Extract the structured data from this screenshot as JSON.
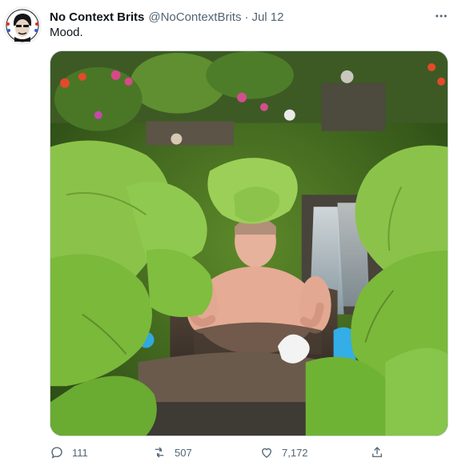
{
  "tweet": {
    "author_name": "No Context Brits",
    "handle": "@NoContextBrits",
    "separator": "·",
    "time": "Jul 12",
    "text": "Mood."
  },
  "icons": {
    "avatar": "avatar-logo",
    "more": "more-icon",
    "reply": "reply-icon",
    "retweet": "retweet-icon",
    "like": "like-icon",
    "share": "share-icon"
  },
  "actions": {
    "reply_count": "111",
    "retweet_count": "507",
    "like_count": "7,172"
  },
  "colors": {
    "text_primary": "#0f1419",
    "text_secondary": "#536471",
    "border": "#cfd9de"
  }
}
